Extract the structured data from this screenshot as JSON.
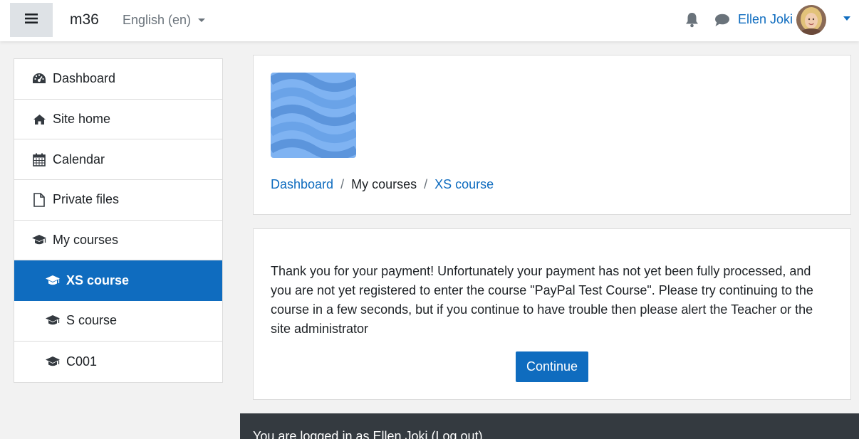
{
  "navbar": {
    "site_name": "m36",
    "language": "English (en)",
    "user_name": "Ellen Joki",
    "icons": [
      "bars-icon",
      "bell-icon",
      "comment-icon",
      "avatar",
      "chevron-down-icon"
    ]
  },
  "sidebar": {
    "items": [
      {
        "label": "Dashboard",
        "icon": "tachometer-icon"
      },
      {
        "label": "Site home",
        "icon": "home-icon"
      },
      {
        "label": "Calendar",
        "icon": "calendar-icon"
      },
      {
        "label": "Private files",
        "icon": "file-icon"
      },
      {
        "label": "My courses",
        "icon": "graduation-cap-icon"
      },
      {
        "label": "XS course",
        "icon": "graduation-cap-icon",
        "active": true
      },
      {
        "label": "S course",
        "icon": "graduation-cap-icon"
      },
      {
        "label": "C001",
        "icon": "graduation-cap-icon"
      }
    ]
  },
  "breadcrumb": {
    "items": [
      "Dashboard",
      "My courses",
      "XS course"
    ],
    "separator": "/"
  },
  "message": {
    "text": "Thank you for your payment! Unfortunately your payment has not yet been fully processed, and you are not yet registered to enter the course \"PayPal Test Course\". Please try continuing to the course in a few seconds, but if you continue to have trouble then please alert the Teacher or the site administrator",
    "continue_label": "Continue"
  },
  "footer": {
    "logged_in_prefix": "You are logged in as ",
    "user_name": "Ellen Joki",
    "logout_open": " (",
    "logout_label": "Log out",
    "logout_close": ")"
  },
  "colors": {
    "primary": "#0f6cbf",
    "drawer_bg": "#f2f2f2",
    "footer_bg": "#343a40"
  }
}
